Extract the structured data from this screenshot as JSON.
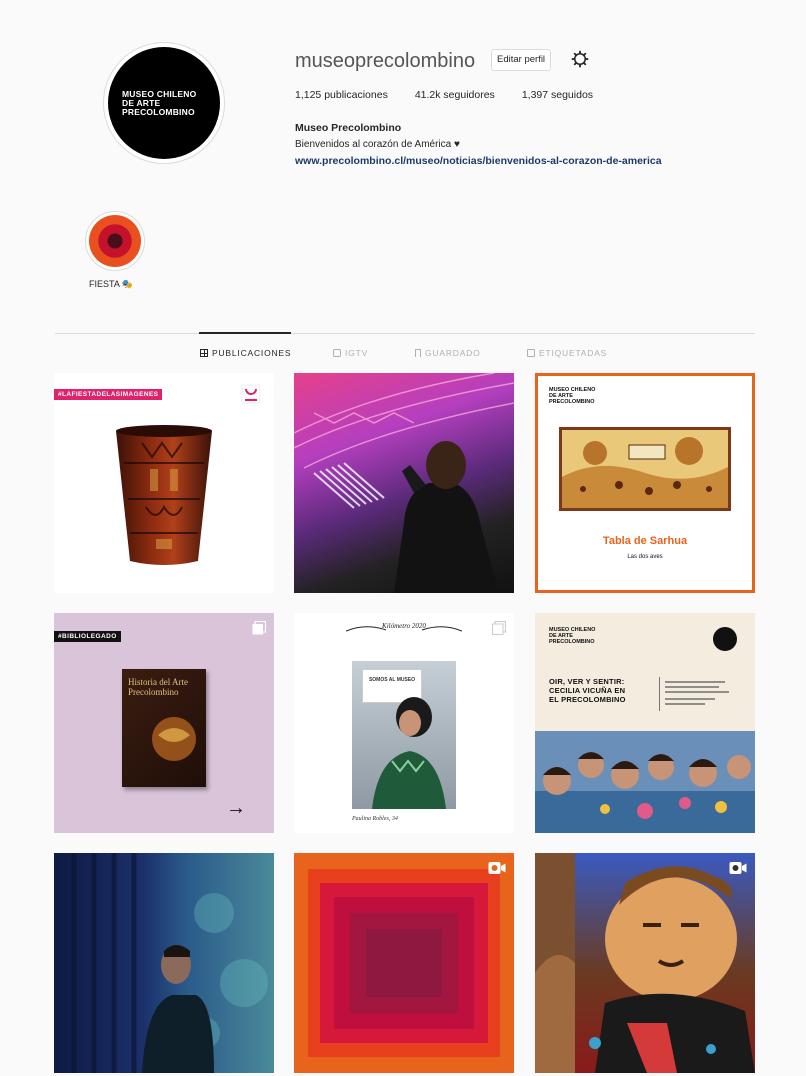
{
  "profile": {
    "username": "museoprecolombino",
    "edit_label": "Editar perfil",
    "avatar_text": "MUSEO CHILENO\nDE ARTE\nPRECOLOMBINO",
    "stats": {
      "posts": "1,125 publicaciones",
      "followers": "41.2k seguidores",
      "following": "1,397 seguidos"
    },
    "name": "Museo Precolombino",
    "bio": "Bienvenidos al corazón de América ♥",
    "link": "www.precolombino.cl/museo/noticias/bienvenidos-al-corazon-de-america"
  },
  "highlights": [
    {
      "label": "FIESTA 🎭"
    }
  ],
  "tabs": [
    {
      "label": "PUBLICACIONES",
      "icon": "grid-icon",
      "active": true
    },
    {
      "label": "IGTV",
      "icon": "igtv-icon",
      "active": false
    },
    {
      "label": "GUARDADO",
      "icon": "bookmark-icon",
      "active": false
    },
    {
      "label": "ETIQUETADAS",
      "icon": "tag-icon",
      "active": false
    }
  ],
  "posts": {
    "p1": {
      "tag": "#LAFIESTADELASIMAGENES",
      "icon": "kero-vessel"
    },
    "p3": {
      "logo": "MUSEO CHILENO\nDE ARTE\nPRECOLOMBINO",
      "title": "Tabla de Sarhua",
      "subtitle": "Las dos aves"
    },
    "p4": {
      "tag": "#BIBLIOLEGADO",
      "book_text": "Historia del Arte Precolombino",
      "arrow": "→"
    },
    "p5": {
      "header": "Kilómetro 2020",
      "sign": "SOMOS AL MUSEO",
      "caption": "Paulina Robles, 34"
    },
    "p6": {
      "logo": "MUSEO CHILENO\nDE ARTE\nPRECOLOMBINO",
      "headline": "OIR, VER Y SENTIR:\nCECILIA VICUÑA EN\nEL PRECOLOMBINO"
    }
  },
  "colors": {
    "accent": "#e8641c",
    "pink": "#e0216b",
    "link": "#1a3b6a"
  }
}
